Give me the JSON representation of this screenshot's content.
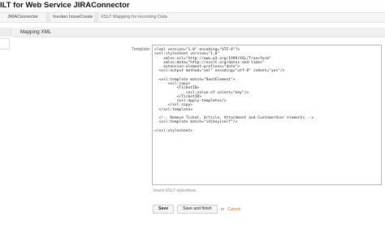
{
  "page": {
    "title": "ILT for Web Service JIRAConnector"
  },
  "breadcrumb": {
    "items": [
      "JIRAConnector",
      "Invoker IssueCreate",
      "XSLT Mapping for incoming Data"
    ]
  },
  "widget": {
    "title": "Mapping XML"
  },
  "template_field": {
    "label": "Template:",
    "value": "<?xml version=\"1.0\" encoding=\"UTF-8\"?>\n<xsl:stylesheet version=\"1.0\"\n    xmlns:xsl=\"http://www.w3.org/1999/XSL/Transform\"\n    xmlns:date=\"http://exslt.org/dates-and-times\"\n    extension-element-prefixes=\"date\">\n  <xsl:output method=\"xml\" encoding=\"utf-8\" indent=\"yes\"/>\n\n  <xsl:template match=\"RootElement\">\n      <xsl:copy>\n          <TicketID>\n              <xsl:value-of select=\"key\"/>\n          </TicketID>\n          <xsl:apply-templates/>\n      </xsl:copy>\n  </xsl:template>\n\n  <!-- Remove Ticket, Article, Attachment and CustomerUser elements -->\n  <xsl:template match=\"id|key|self\"/>\n\n</xsl:stylesheet>",
    "hint": "Insert XSLT stylesheet."
  },
  "actions": {
    "save_label": "Save",
    "save_finish_label": "Save and finish",
    "or_text": "or",
    "cancel_label": "Cancel"
  }
}
